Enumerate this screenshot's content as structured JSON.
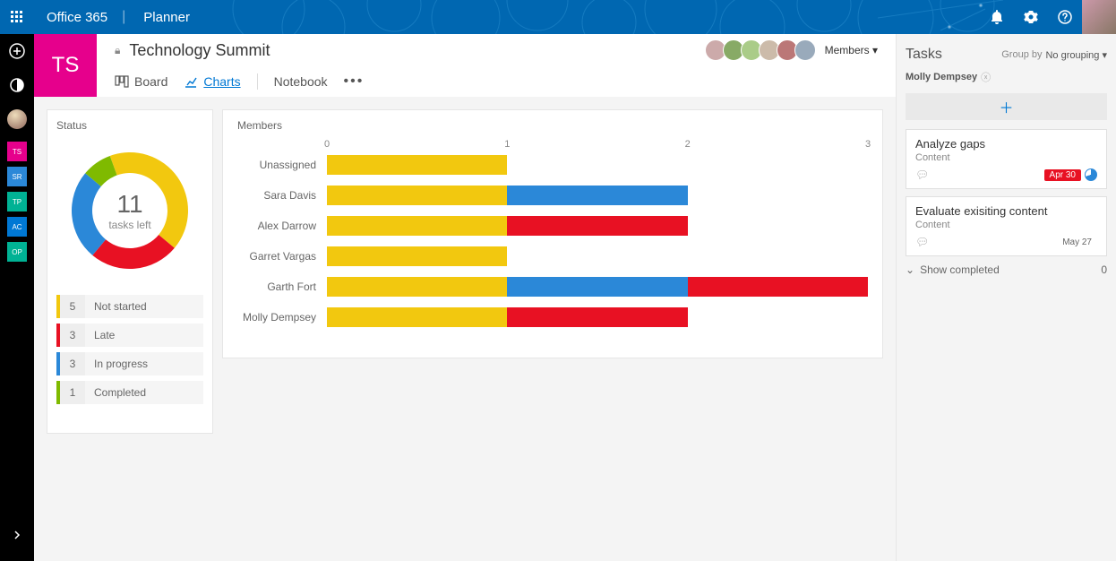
{
  "suite": {
    "brand": "Office 365",
    "app": "Planner"
  },
  "rail_plans": [
    {
      "code": "TS",
      "color": "#e6008c"
    },
    {
      "code": "SR",
      "color": "#2b88d8"
    },
    {
      "code": "TP",
      "color": "#00b294"
    },
    {
      "code": "AC",
      "color": "#0078d4"
    },
    {
      "code": "OP",
      "color": "#00b294"
    }
  ],
  "plan": {
    "tile": "TS",
    "title": "Technology Summit",
    "members_label": "Members",
    "tabs": {
      "board": "Board",
      "charts": "Charts",
      "notebook": "Notebook"
    }
  },
  "status_card": {
    "title": "Status",
    "tasks_left_num": "11",
    "tasks_left_label": "tasks left",
    "legend": [
      {
        "label": "Not started",
        "count": "5",
        "color": "#F2C80F"
      },
      {
        "label": "Late",
        "count": "3",
        "color": "#E81123"
      },
      {
        "label": "In progress",
        "count": "3",
        "color": "#2B88D8"
      },
      {
        "label": "Completed",
        "count": "1",
        "color": "#7FBA00"
      }
    ]
  },
  "members_card": {
    "title": "Members",
    "axis": [
      "0",
      "1",
      "2",
      "3"
    ]
  },
  "tasks_panel": {
    "title": "Tasks",
    "group_by_label": "Group by",
    "group_by_value": "No grouping",
    "filter_person": "Molly Dempsey",
    "show_completed_label": "Show completed",
    "show_completed_count": "0",
    "tasks": [
      {
        "name": "Analyze gaps",
        "category": "Content",
        "due": "Apr 30",
        "due_style": "red",
        "has_icon": true
      },
      {
        "name": "Evaluate exisiting content",
        "category": "Content",
        "due": "May 27",
        "due_style": "plain",
        "has_icon": false
      }
    ]
  },
  "chart_data": [
    {
      "type": "pie",
      "title": "Status",
      "series": [
        {
          "name": "Not started",
          "value": 5,
          "color": "#F2C80F"
        },
        {
          "name": "Late",
          "value": 3,
          "color": "#E81123"
        },
        {
          "name": "In progress",
          "value": 3,
          "color": "#2B88D8"
        },
        {
          "name": "Completed",
          "value": 1,
          "color": "#7FBA00"
        }
      ],
      "center_label": "11 tasks left"
    },
    {
      "type": "bar",
      "title": "Members",
      "orientation": "horizontal",
      "stacked": true,
      "xlim": [
        0,
        3
      ],
      "xlabel": "",
      "ylabel": "",
      "categories": [
        "Unassigned",
        "Sara Davis",
        "Alex Darrow",
        "Garret Vargas",
        "Garth Fort",
        "Molly Dempsey"
      ],
      "series": [
        {
          "name": "Not started",
          "color": "#F2C80F",
          "values": [
            1,
            1,
            1,
            1,
            1,
            1
          ]
        },
        {
          "name": "In progress",
          "color": "#2B88D8",
          "values": [
            0,
            1,
            0,
            0,
            1,
            0
          ]
        },
        {
          "name": "Late",
          "color": "#E81123",
          "values": [
            0,
            0,
            1,
            0,
            1,
            1
          ]
        }
      ]
    }
  ]
}
